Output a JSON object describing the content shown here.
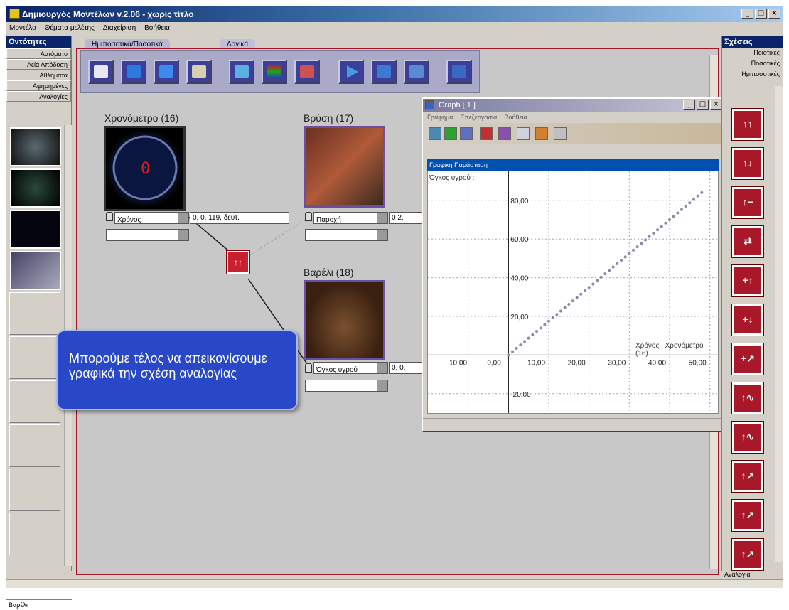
{
  "window": {
    "title": "Δημιουργός Μοντέλων v.2.06 - χωρίς τίτλο"
  },
  "menu": [
    "Μοντέλο",
    "Θέματα μελέτης",
    "Διαχείριση",
    "Βοήθεια"
  ],
  "left_panel": {
    "title": "Οντότητες",
    "categories": [
      "Αυτόματο",
      "Λεία Απόδοση",
      "Αθλήματα",
      "Αφηρημένες",
      "Αναλογίες"
    ],
    "status": "Βαρέλι"
  },
  "tabs": [
    "Ημιποσοτικά/Ποσοτικά",
    "Λογικά"
  ],
  "entities": {
    "chrono": {
      "title": "Χρονόμετρο (16)",
      "var": "Χρόνος",
      "value": "0,   0,   119,   δευτ."
    },
    "tap": {
      "title": "Βρύση (17)",
      "var": "Παροχή",
      "value": "0   2,"
    },
    "barrel": {
      "title": "Βαρέλι (18)",
      "var": "Όγκος υγρού",
      "value": "0,   0,"
    }
  },
  "callout": "Μπορούμε τέλος να απεικονίσουμε γραφικά την σχέση αναλογίας",
  "graph": {
    "title": "Graph [ 1 ]",
    "menu": [
      "Γράφημα",
      "Επεξεργασία",
      "Βοήθεια"
    ],
    "panel_title": "Γραφική Παράσταση",
    "y_label": "Όγκος υγρού :",
    "x_label": "Χρόνος : Χρονόμετρο (16)",
    "x_ticks": [
      "-10,00",
      "0,00",
      "10,00",
      "20,00",
      "30,00",
      "40,00",
      "50,00"
    ],
    "y_ticks": [
      "80,00",
      "60,00",
      "40,00",
      "20,00",
      "-20,00"
    ]
  },
  "right_panel": {
    "title": "Σχέσεις",
    "categories": [
      "Ποιοτικές",
      "Ποσοτικές",
      "Ημιποσοτικές"
    ],
    "status": "Αναλογία",
    "relations": [
      "↑↑",
      "↑↓",
      "↑−",
      "⇄",
      "+↑",
      "+↓",
      "+↗",
      "↑∿",
      "↑∿",
      "↑↗",
      "↑↗",
      "↑↗"
    ]
  },
  "chart_data": {
    "type": "scatter",
    "title": "Γραφική Παράσταση",
    "xlabel": "Χρόνος : Χρονόμετρο (16)",
    "ylabel": "Όγκος υγρού :",
    "xlim": [
      -20,
      52
    ],
    "ylim": [
      -30,
      95
    ],
    "series": [
      {
        "name": "Όγκος υγρού",
        "x": [
          0,
          4,
          8,
          12,
          16,
          20,
          24,
          28,
          32,
          36,
          40,
          44,
          48
        ],
        "y": [
          0,
          7,
          14,
          21,
          28,
          35,
          42,
          49,
          56,
          63,
          70,
          77,
          84
        ]
      }
    ]
  }
}
